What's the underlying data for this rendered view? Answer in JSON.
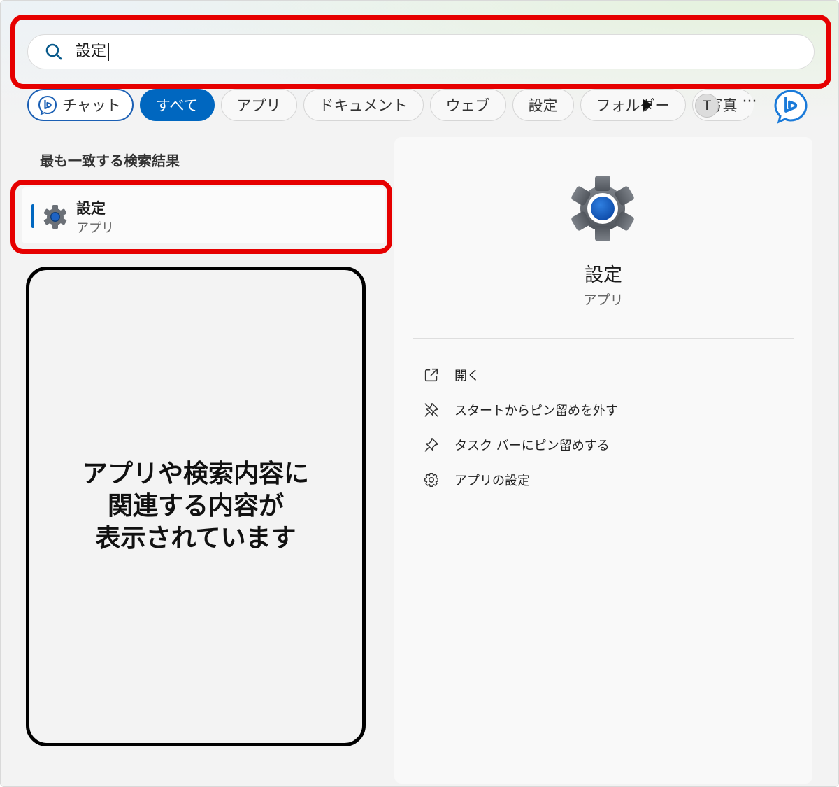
{
  "search": {
    "query": "設定"
  },
  "tabs": [
    {
      "label": "チャット",
      "kind": "chat"
    },
    {
      "label": "すべて",
      "kind": "active"
    },
    {
      "label": "アプリ"
    },
    {
      "label": "ドキュメント"
    },
    {
      "label": "ウェブ"
    },
    {
      "label": "設定"
    },
    {
      "label": "フォルダー"
    },
    {
      "label": "写真"
    }
  ],
  "header_right": {
    "avatar_initial": "T",
    "more": "···"
  },
  "results": {
    "section_title": "最も一致する検索結果",
    "best_match": {
      "name": "設定",
      "type": "アプリ"
    }
  },
  "note": {
    "text": "アプリや検索内容に\n関連する内容が\n表示されています"
  },
  "detail": {
    "title": "設定",
    "subtitle": "アプリ",
    "actions": [
      {
        "label": "開く",
        "icon": "open-external-icon"
      },
      {
        "label": "スタートからピン留めを外す",
        "icon": "unpin-icon"
      },
      {
        "label": "タスク バーにピン留めする",
        "icon": "pin-icon"
      },
      {
        "label": "アプリの設定",
        "icon": "gear-outline-icon"
      }
    ]
  },
  "colors": {
    "accent": "#0067c0",
    "highlight": "#e60000"
  }
}
